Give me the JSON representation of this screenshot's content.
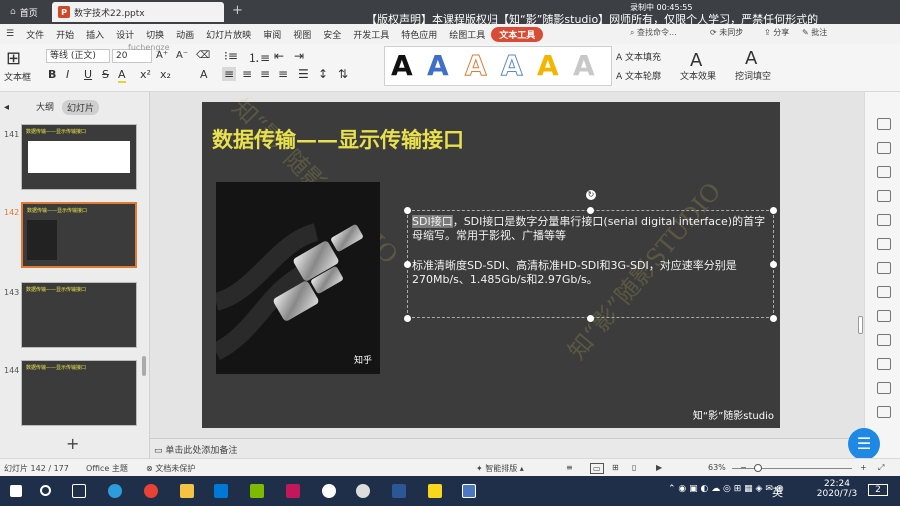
{
  "titlebar": {
    "home_tab": "首页",
    "doc_tab": "数字技术22.pptx",
    "notice": "【版权声明】本课程版权归【知“影”随影studio】网师所有，仅限个人学习，严禁任何形式的",
    "recording": "录制中 00:45:55"
  },
  "menubar": {
    "items": [
      "文件",
      "开始",
      "插入",
      "设计",
      "切换",
      "动画",
      "幻灯片放映",
      "审阅",
      "视图",
      "安全",
      "开发工具",
      "特色应用",
      "绘图工具"
    ],
    "active_item": "文本工具",
    "search_placeholder": "查找命令...",
    "sync": "未同步",
    "share": "分享",
    "comment": "批注"
  },
  "ribbon": {
    "textbox_label": "文本框",
    "font_name": "等线 (正文)",
    "font_size": "20",
    "username_hint": "fuchengze",
    "format_buttons": [
      "B",
      "I",
      "U",
      "S",
      "A",
      "x²",
      "x₂",
      "A"
    ],
    "text_fill": "文本填充",
    "text_outline": "文本轮廓",
    "text_effect": "文本效果",
    "art_fill": "挖词填空"
  },
  "left_pane": {
    "tab_outline": "大纲",
    "tab_slides": "幻灯片",
    "thumbnails": [
      {
        "num": "141",
        "title": "数据传输——显示传输接口"
      },
      {
        "num": "142",
        "title": "数据传输——显示传输接口"
      },
      {
        "num": "143",
        "title": "数据传输——显示传输接口"
      },
      {
        "num": "144",
        "title": "数据传输——显示传输接口"
      }
    ]
  },
  "slide": {
    "title": "数据传输——显示传输接口",
    "image_watermark": "知乎",
    "para1_highlight": "SDI接口",
    "para1_rest": "，SDI接口是数字分量串行接口(serial digital interface)的首字母缩写。常用于影视、广播等等",
    "para2": "标准清晰度SD-SDI、高清标准HD-SDI和3G-SDI，对应速率分别是270Mb/s、1.485Gb/s和2.97Gb/s。",
    "watermark": "知“影”随影studio",
    "diag_watermark": "知“影”随影STUDIO"
  },
  "notes": {
    "placeholder": "单击此处添加备注"
  },
  "statusbar": {
    "slide_count": "幻灯片 142 / 177",
    "theme": "Office 主题",
    "protect": "文档未保护",
    "smart": "智能排版",
    "zoom": "63%"
  },
  "taskbar": {
    "ime": "英",
    "time": "22:24",
    "date": "2020/7/3",
    "notif_count": "2"
  }
}
